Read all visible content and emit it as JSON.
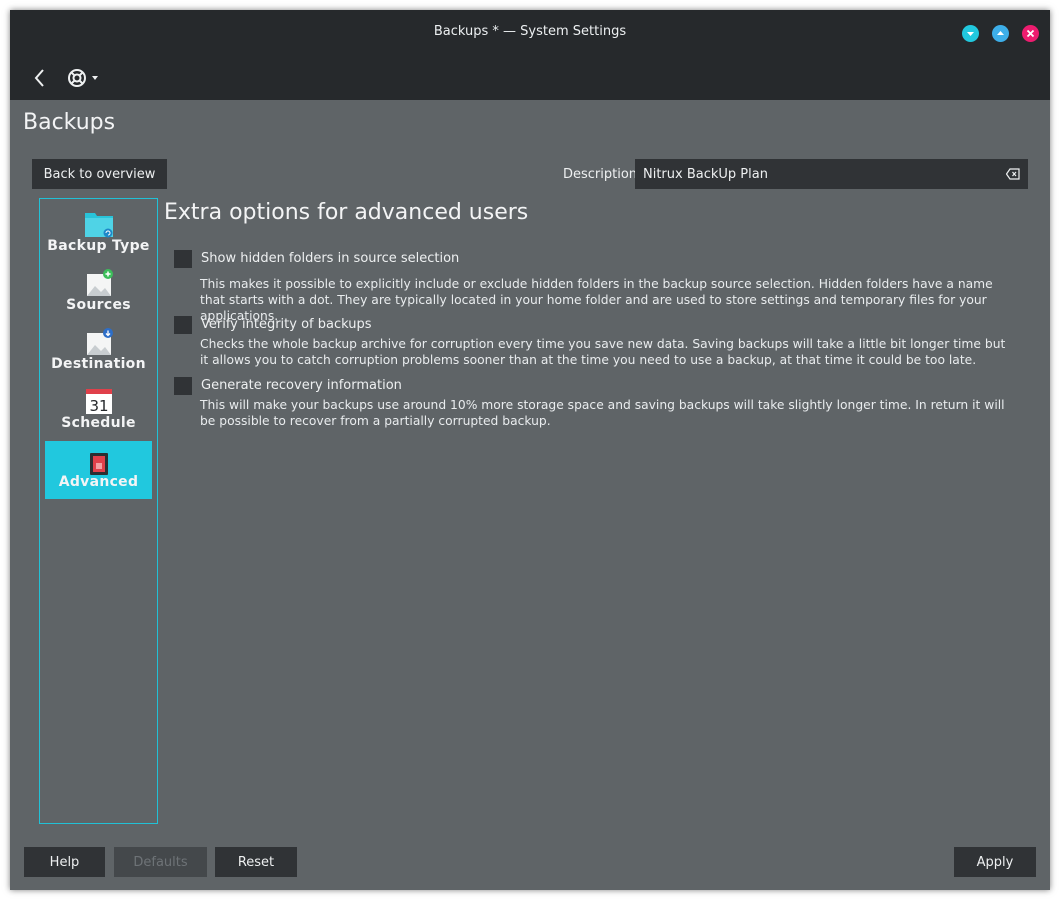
{
  "window": {
    "title": "Backups * — System Settings"
  },
  "toolbar": {
    "back_icon": "chevron-left-icon",
    "help_icon": "lifebuoy-icon"
  },
  "page": {
    "title": "Backups"
  },
  "header": {
    "back_to_overview_label": "Back to overview",
    "description_label": "Description:",
    "description_value": "Nitrux BackUp Plan"
  },
  "sidebar": {
    "items": [
      {
        "label": "Backup Type",
        "icon": "folder-icon",
        "active": false
      },
      {
        "label": "Sources",
        "icon": "drive-add-icon",
        "active": false
      },
      {
        "label": "Destination",
        "icon": "drive-download-icon",
        "active": false
      },
      {
        "label": "Schedule",
        "icon": "calendar-icon",
        "active": false,
        "icon_text": "31"
      },
      {
        "label": "Advanced",
        "icon": "settings-switch-icon",
        "active": true
      }
    ]
  },
  "main": {
    "section_title": "Extra options for advanced users",
    "options": [
      {
        "label": "Show hidden folders in source selection",
        "checked": false,
        "description": "This makes it possible to explicitly include or exclude hidden folders in the backup source selection. Hidden folders have a name that starts with a dot. They are typically located in your home folder and are used to store settings and temporary files for your applications."
      },
      {
        "label": "Verify integrity of backups",
        "checked": false,
        "description": "Checks the whole backup archive for corruption every time you save new data. Saving backups will take a little bit longer time but it allows you to catch corruption problems sooner than at the time you need to use a backup, at that time it could be too late."
      },
      {
        "label": "Generate recovery information",
        "checked": false,
        "description": "This will make your backups use around 10% more storage space and saving backups will take slightly longer time. In return it will be possible to recover from a partially corrupted backup."
      }
    ]
  },
  "footer": {
    "help_label": "Help",
    "defaults_label": "Defaults",
    "reset_label": "Reset",
    "apply_label": "Apply"
  },
  "colors": {
    "titlebar": "#26292c",
    "background": "#5f6467",
    "accent": "#21c8de",
    "button": "#303336",
    "minimize": "#21c8de",
    "maximize": "#3daee9",
    "close": "#ed1c6f"
  }
}
